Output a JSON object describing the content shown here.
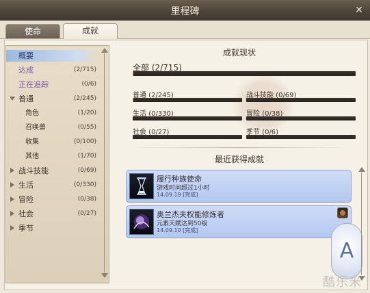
{
  "window": {
    "title": "里程碑",
    "close_label": "✕"
  },
  "tabs": [
    {
      "label": "使命",
      "active": false
    },
    {
      "label": "成就",
      "active": true
    }
  ],
  "sidebar": {
    "items": [
      {
        "label": "概要",
        "count": "",
        "selected": true
      },
      {
        "label": "达成",
        "count": "(2/715)"
      },
      {
        "label": "正在追踪",
        "count": "(0/6)"
      },
      {
        "label": "普通",
        "count": "(2/245)",
        "expanded": true
      },
      {
        "label": "角色",
        "count": "(1/20)"
      },
      {
        "label": "召唤兽",
        "count": "(0/55)"
      },
      {
        "label": "收集",
        "count": "(0/100)"
      },
      {
        "label": "其他",
        "count": "(1/70)"
      },
      {
        "label": "战斗技能",
        "count": "(0/69)"
      },
      {
        "label": "生活",
        "count": "(0/330)"
      },
      {
        "label": "冒险",
        "count": "(0/38)"
      },
      {
        "label": "社会",
        "count": "(0/27)"
      },
      {
        "label": "季节",
        "count": "(0/6)"
      }
    ]
  },
  "status": {
    "title": "成就现状",
    "total": {
      "label": "全部 (2/715)",
      "progress": 0.003
    },
    "categories": [
      {
        "label": "普通 (2/245)",
        "progress": 0.008
      },
      {
        "label": "战斗技能 (0/69)",
        "progress": 0
      },
      {
        "label": "生活 (0/330)",
        "progress": 0
      },
      {
        "label": "冒险 (0/38)",
        "progress": 0
      },
      {
        "label": "社会 (0/27)",
        "progress": 0
      },
      {
        "label": "季节 (0/6)",
        "progress": 0
      }
    ]
  },
  "recent": {
    "title": "最近获得成就",
    "items": [
      {
        "name": "履行种族使命",
        "desc": "游戏时间超过1小时",
        "date": "14.09.19 [完成]",
        "icon": "hourglass-icon"
      },
      {
        "name": "奥兰杰夫权能修炼者",
        "desc": "元素天赋达到50级",
        "date": "14.09.10 [完成]",
        "icon": "magic-orb-icon"
      }
    ]
  },
  "watermark": "酷乐米"
}
